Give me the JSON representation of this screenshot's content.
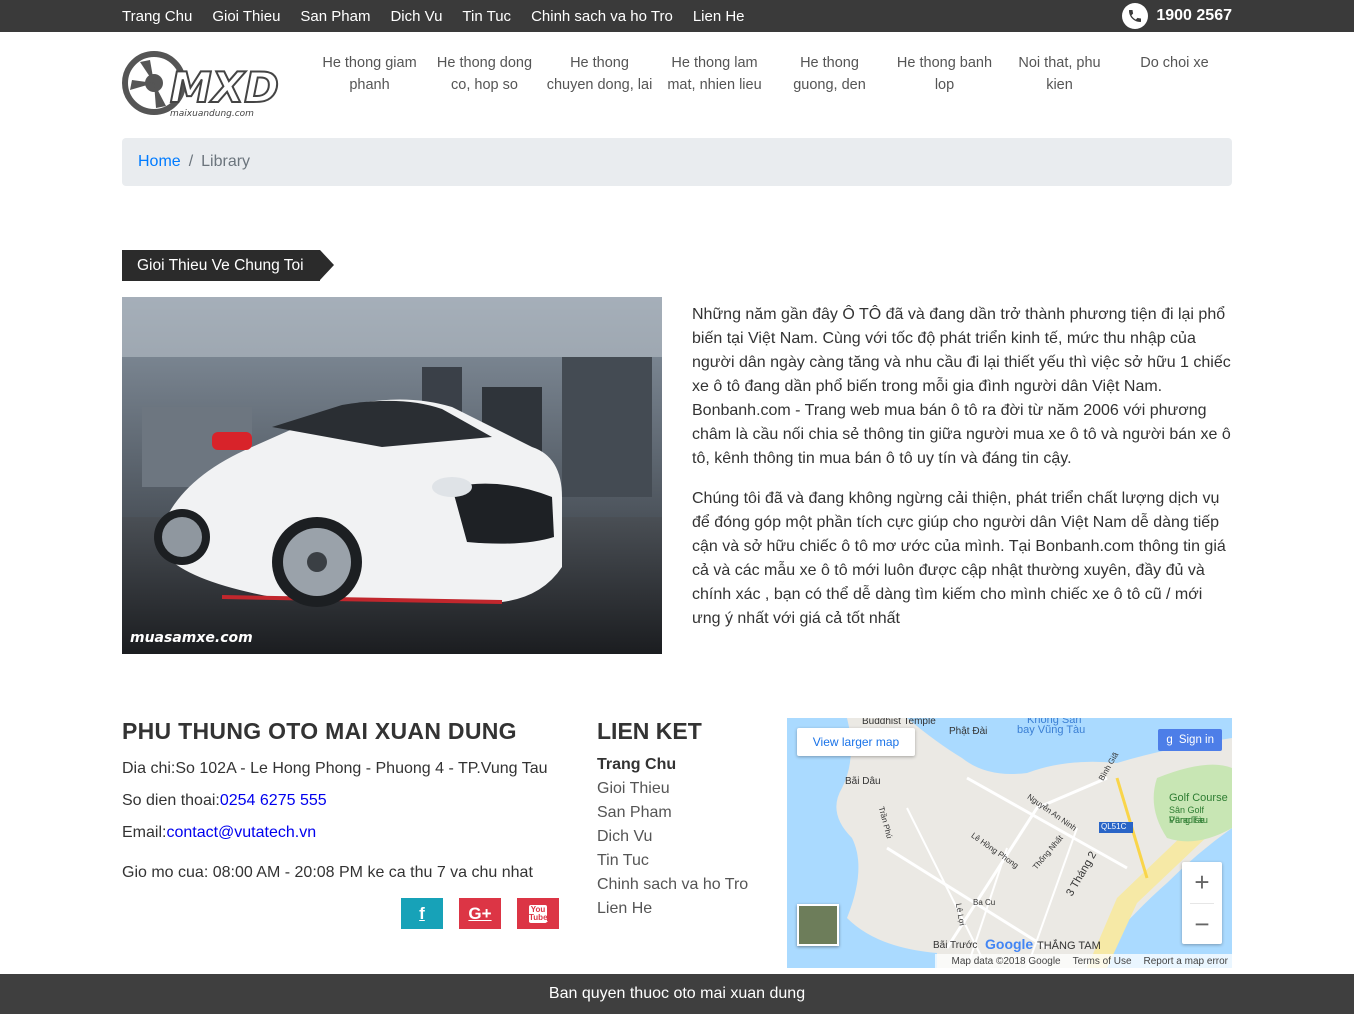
{
  "topnav": {
    "items": [
      "Trang Chu",
      "Gioi Thieu",
      "San Pham",
      "Dich Vu",
      "Tin Tuc",
      "Chinh sach va ho Tro",
      "Lien He"
    ],
    "hotline": "1900 2567"
  },
  "logo": {
    "text": "MXD",
    "subtext": "maixuandung.com"
  },
  "mainnav": {
    "items": [
      "He thong giam phanh",
      "He thong dong co, hop so",
      "He thong chuyen dong, lai",
      "He thong lam mat, nhien lieu",
      "He thong guong, den",
      "He thong banh lop",
      "Noi that, phu kien",
      "Do choi xe"
    ]
  },
  "breadcrumb": {
    "home": "Home",
    "separator": "/",
    "current": "Library"
  },
  "about": {
    "title": "Gioi Thieu Ve Chung Toi",
    "image_watermark": "muasamxe.com",
    "paragraphs": [
      "Những năm gần đây Ô TÔ đã và đang dần trở thành phương tiện đi lại phổ biến tại Việt Nam. Cùng với tốc độ phát triển kinh tế, mức thu nhập của người dân ngày càng tăng và nhu cầu đi lại thiết yếu thì việc sở hữu 1 chiếc xe ô tô đang dần phổ biến trong mỗi gia đình người dân Việt Nam. Bonbanh.com - Trang web mua bán ô tô ra đời từ năm 2006 với phương châm là cầu nối chia sẻ thông tin giữa người mua xe ô tô và người bán xe ô tô, kênh thông tin mua bán ô tô uy tín và đáng tin cậy.",
      "Chúng tôi đã và đang không ngừng cải thiện, phát triển chất lượng dịch vụ để đóng góp một phần tích cực giúp cho người dân Việt Nam dễ dàng tiếp cận và sở hữu chiếc ô tô mơ ước của mình. Tại Bonbanh.com thông tin giá cả và các mẫu xe ô tô mới luôn được cập nhật thường xuyên, đầy đủ và chính xác , bạn có thể dễ dàng tìm kiếm cho mình chiếc xe ô tô cũ / mới ưng ý nhất với giá cả tốt nhất"
    ]
  },
  "company": {
    "name": "PHU THUNG OTO MAI XUAN DUNG",
    "address_label": "Dia chi:",
    "address": "So 102A - Le Hong Phong - Phuong 4 - TP.Vung Tau",
    "phone_label": "So dien thoai:",
    "phone": "0254 6275 555",
    "email_label": "Email:",
    "email": "contact@vutatech.vn",
    "hours": "Gio mo cua: 08:00 AM - 20:08 PM ke ca thu 7 va chu nhat"
  },
  "social": [
    {
      "name": "facebook",
      "glyph": "f",
      "color": "#17a2b8"
    },
    {
      "name": "google-plus",
      "glyph": "G+",
      "color": "#dc3545"
    },
    {
      "name": "youtube",
      "glyph": "You Tube",
      "color": "#dc3545"
    }
  ],
  "links": {
    "title": "LIEN KET",
    "items": [
      "Trang Chu",
      "Gioi Thieu",
      "San Pham",
      "Dich Vu",
      "Tin Tuc",
      "Chinh sach va ho Tro",
      "Lien He"
    ]
  },
  "map": {
    "view_larger": "View larger map",
    "sign_in": "Sign in",
    "zoom_in": "+",
    "zoom_out": "−",
    "google": "Google",
    "attribution": "Map data ©2018 Google",
    "terms": "Terms of Use",
    "report": "Report a map error",
    "labels": [
      "Buddhist Temple",
      "Phật Đài",
      "Khong San",
      "bay Vũng Tàu",
      "Bãi Dâu",
      "Golf Course",
      "Sân Golf Paradise",
      "Vũng Tàu",
      "QL51C",
      "Bãi Trước",
      "THẮNG TAM",
      "Lê Hồng Phong",
      "3 Tháng 2",
      "Nguyễn An Ninh",
      "Thống Nhất",
      "Trần Phú",
      "Ba Cu",
      "Lê Lợi",
      "Bình Giã"
    ]
  },
  "footer": {
    "copyright": "Ban quyen thuoc oto mai xuan dung"
  }
}
